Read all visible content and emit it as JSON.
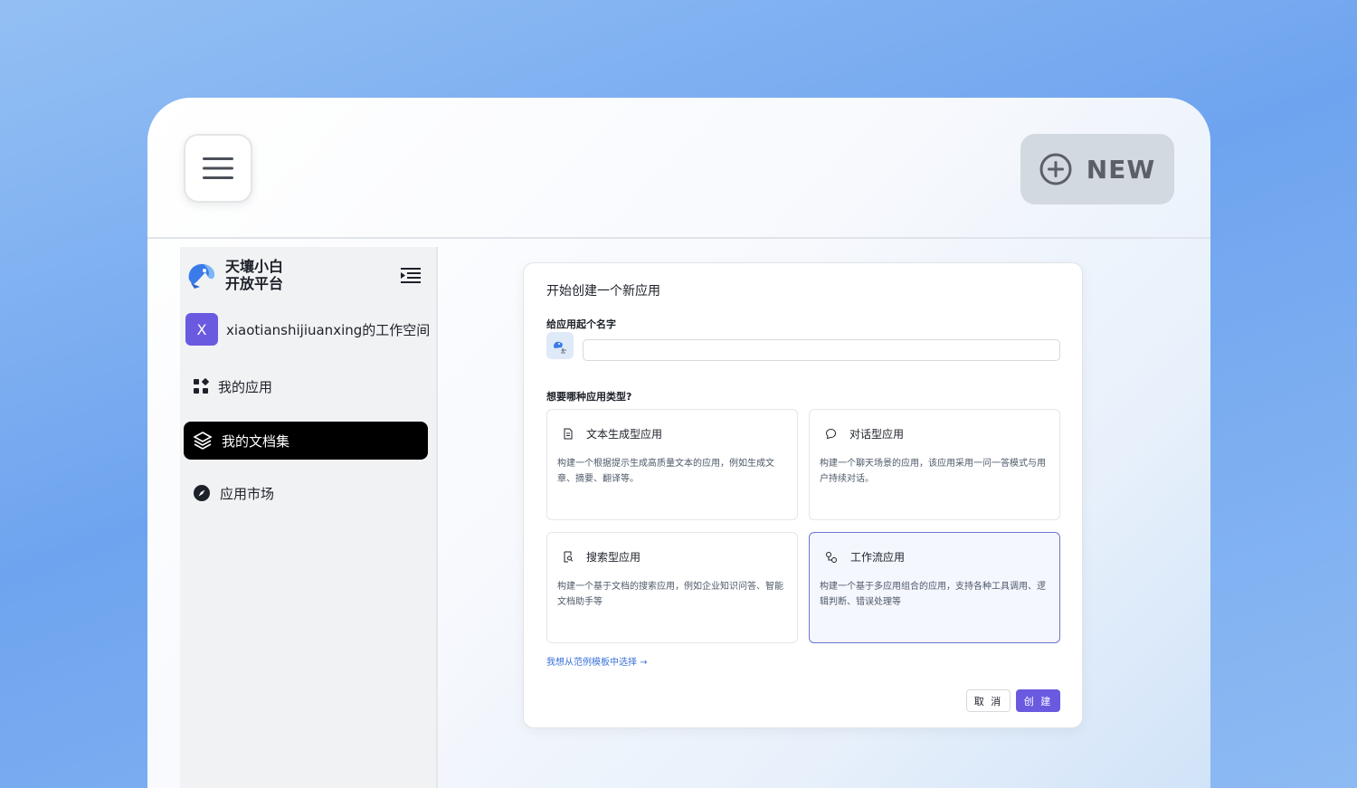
{
  "header": {
    "new_label": "NEW"
  },
  "sidebar": {
    "brand_line1": "天壤小白",
    "brand_line2": "开放平台",
    "workspace_initial": "X",
    "workspace_name": "xiaotianshijiuanxing的工作空间",
    "items": [
      {
        "label": "我的应用",
        "icon": "apps-grid-icon"
      },
      {
        "label": "我的文档集",
        "icon": "layers-icon",
        "active": true
      },
      {
        "label": "应用市场",
        "icon": "compass-icon"
      }
    ]
  },
  "dialog": {
    "title": "开始创建一个新应用",
    "name_label": "给应用起个名字",
    "name_value": "",
    "type_label": "想要哪种应用类型?",
    "types": [
      {
        "title": "文本生成型应用",
        "desc": "构建一个根据提示生成高质量文本的应用，例如生成文章、摘要、翻译等。",
        "icon": "document-icon"
      },
      {
        "title": "对话型应用",
        "desc": "构建一个聊天场景的应用，该应用采用一问一答模式与用户持续对话。",
        "icon": "chat-bubble-icon"
      },
      {
        "title": "搜索型应用",
        "desc": "构建一个基于文档的搜索应用，例如企业知识问答、智能文档助手等",
        "icon": "doc-search-icon"
      },
      {
        "title": "工作流应用",
        "desc": "构建一个基于多应用组合的应用，支持各种工具调用、逻辑判断、错误处理等",
        "icon": "workflow-icon",
        "selected": true
      }
    ],
    "template_link": "我想从范例模板中选择 →",
    "cancel_label": "取 消",
    "create_label": "创 建"
  },
  "colors": {
    "accent": "#6a5ae0",
    "link": "#3b72d8",
    "selected_border": "#6b74d6"
  }
}
